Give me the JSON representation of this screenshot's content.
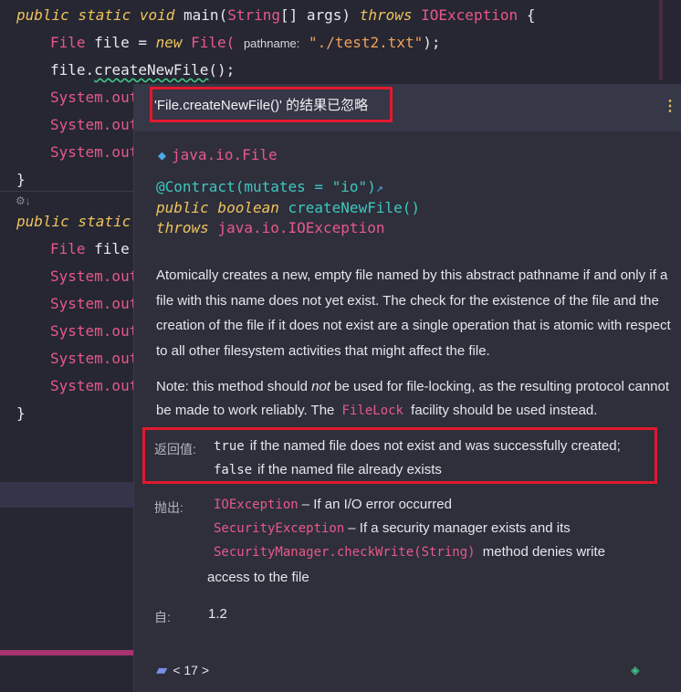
{
  "code": {
    "l1": {
      "kw1": "public static void",
      "name": "main(",
      "type": "String",
      "rest": "[] args) ",
      "kw2": "throws",
      "exc": "IOException",
      "brace": " {"
    },
    "l2": {
      "type1": "File",
      "mid": " file = ",
      "kw": "new",
      "type2": "File(",
      "hint": "pathname:",
      "str": "\"./test2.txt\"",
      "end": ");"
    },
    "l3": {
      "obj": "file.",
      "call": "createNewFile",
      "end": "();"
    },
    "sys": "System.out",
    "close_brace": "}",
    "l_static": "public static",
    "l_file": {
      "type": "File",
      "name": " file"
    }
  },
  "popup": {
    "warning": "'File.createNewFile()' 的结果已忽略",
    "class_name": "java.io.File",
    "signature": {
      "annotation": "@Contract(mutates = \"io\")",
      "line2_kw": "public boolean",
      "line2_method": "createNewFile()",
      "line3_kw": "throws",
      "line3_type": "java.io.IOException"
    },
    "description": "Atomically creates a new, empty file named by this abstract pathname if and only if a file with this name does not yet exist. The check for the existence of the file and the creation of the file if it does not exist are a single operation that is atomic with respect to all other filesystem activities that might affect the file.",
    "note": {
      "pre": "Note: this method should ",
      "em": "not",
      "mid": " be used for file-locking, as the resulting protocol cannot be made to work reliably. The ",
      "code": "FileLock",
      "post": " facility should be used instead."
    },
    "returns": {
      "label": "返回值:",
      "true_kw": "true",
      "true_text": "if the named file does not exist and was successfully created;",
      "false_kw": "false",
      "false_text": "if the named file already exists"
    },
    "throws": {
      "label": "抛出:",
      "e1": "IOException",
      "e1_text": "– If an I/O error occurred",
      "e2": "SecurityException",
      "e2_text": "– If a security manager exists and its",
      "e3": "SecurityManager.checkWrite(String)",
      "e3_text": "method denies write",
      "e3_cont": "access to the file"
    },
    "since": {
      "label": "自:",
      "value": "1.2"
    },
    "nav": "< 17 >"
  },
  "icons": {
    "cube": "class-cube-icon",
    "kebab": "more-vertical-icon",
    "folder": "folder-icon",
    "file": "java-file-icon",
    "external": "external-link-icon"
  }
}
